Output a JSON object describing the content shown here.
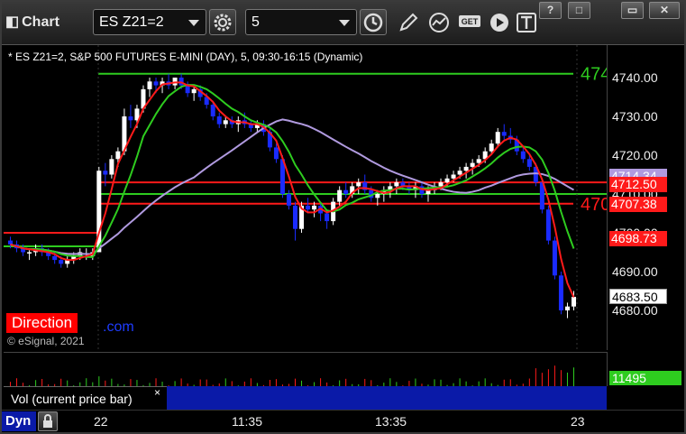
{
  "window": {
    "title": "Chart",
    "buttons": [
      "?",
      "□",
      "▭",
      "✕"
    ]
  },
  "toolbar": {
    "symbol_value": "ES Z21=2",
    "interval_value": "5",
    "icons": [
      "settings-gear-icon",
      "clock-icon",
      "draw-pencil-icon",
      "studies-icon",
      "get-data-icon",
      "play-icon",
      "text-tool-icon"
    ]
  },
  "chart": {
    "header": "* ES Z21=2, S&P 500 FUTURES E-MINI (DAY), 5, 09:30-16:15 (Dynamic)",
    "direction_label": "Direction",
    "com_text": ".com",
    "copyright": "© eSignal, 2021",
    "right_partial_labels": [
      {
        "text": "474",
        "color": "#2ecc1f"
      },
      {
        "text": "470",
        "color": "#ff1a1a"
      }
    ],
    "colors": {
      "up_candle": "#ffffff",
      "down_candle": "#1a2bff",
      "green_line": "#2ecc1f",
      "red_line": "#ff1a1a",
      "purple_line": "#b09adf"
    }
  },
  "price_axis": {
    "ticks": [
      "4740.00",
      "4730.00",
      "4720.00",
      "4710.00",
      "4700.00",
      "4690.00",
      "4680.00"
    ],
    "tags": [
      {
        "text": "4714.34",
        "bg": "#b09adf",
        "fg": "#ffffff"
      },
      {
        "text": "4712.50",
        "bg": "#ff1a1a",
        "fg": "#ffffff"
      },
      {
        "text": "4707.38",
        "bg": "#ff1a1a",
        "fg": "#ffffff"
      },
      {
        "text": "4698.73",
        "bg": "#ff1a1a",
        "fg": "#ffffff"
      },
      {
        "text": "4683.50",
        "bg": "#ffffff",
        "fg": "#000000"
      }
    ]
  },
  "volume": {
    "label": "Vol (current price bar)",
    "close_glyph": "×",
    "current_value": "11495"
  },
  "time_axis": {
    "labels": [
      "22",
      "11:35",
      "13:35",
      "23"
    ],
    "dyn_label": "Dyn"
  },
  "chart_data": {
    "type": "candlestick",
    "y_range": [
      4675,
      4745
    ],
    "levels": [
      {
        "name": "green-high",
        "value": 4741
      },
      {
        "name": "red-upper",
        "value": 4713
      },
      {
        "name": "green-mid",
        "value": 4710
      },
      {
        "name": "red-lower",
        "value": 4707.5
      },
      {
        "name": "green-prior",
        "value": 4696.5
      },
      {
        "name": "red-prior",
        "value": 4700
      }
    ],
    "candles": [
      [
        4698,
        4699,
        4696,
        4697
      ],
      [
        4697,
        4698,
        4695,
        4696
      ],
      [
        4696,
        4697,
        4694,
        4695
      ],
      [
        4695,
        4696,
        4693,
        4695
      ],
      [
        4695,
        4697,
        4694,
        4696
      ],
      [
        4696,
        4697,
        4694,
        4695
      ],
      [
        4695,
        4696,
        4693,
        4694
      ],
      [
        4694,
        4695,
        4692,
        4693
      ],
      [
        4693,
        4694,
        4691,
        4692
      ],
      [
        4692,
        4694,
        4691,
        4693
      ],
      [
        4693,
        4695,
        4692,
        4694
      ],
      [
        4694,
        4696,
        4693,
        4695
      ],
      [
        4694,
        4696,
        4693,
        4694
      ],
      [
        4694,
        4696,
        4693,
        4695
      ],
      [
        4695,
        4717,
        4695,
        4716
      ],
      [
        4716,
        4718,
        4712,
        4715
      ],
      [
        4715,
        4720,
        4714,
        4719
      ],
      [
        4719,
        4722,
        4717,
        4721
      ],
      [
        4721,
        4732,
        4720,
        4730
      ],
      [
        4730,
        4733,
        4727,
        4729
      ],
      [
        4729,
        4733,
        4727,
        4732
      ],
      [
        4732,
        4738,
        4731,
        4737
      ],
      [
        4737,
        4740,
        4735,
        4739
      ],
      [
        4739,
        4740,
        4736,
        4738
      ],
      [
        4738,
        4740,
        4736,
        4739
      ],
      [
        4739,
        4741,
        4737,
        4738
      ],
      [
        4738,
        4740,
        4737,
        4740
      ],
      [
        4740,
        4741,
        4737,
        4738
      ],
      [
        4738,
        4739,
        4735,
        4736
      ],
      [
        4736,
        4738,
        4734,
        4737
      ],
      [
        4737,
        4738,
        4734,
        4735
      ],
      [
        4735,
        4736,
        4732,
        4733
      ],
      [
        4733,
        4734,
        4729,
        4730
      ],
      [
        4730,
        4731,
        4727,
        4728
      ],
      [
        4728,
        4730,
        4727,
        4729
      ],
      [
        4729,
        4730,
        4727,
        4728
      ],
      [
        4728,
        4730,
        4726,
        4729
      ],
      [
        4729,
        4731,
        4727,
        4728
      ],
      [
        4728,
        4729,
        4726,
        4727
      ],
      [
        4727,
        4729,
        4726,
        4728
      ],
      [
        4728,
        4729,
        4725,
        4726
      ],
      [
        4726,
        4727,
        4721,
        4722
      ],
      [
        4722,
        4723,
        4718,
        4719
      ],
      [
        4719,
        4720,
        4709,
        4710
      ],
      [
        4710,
        4711,
        4706,
        4707
      ],
      [
        4707,
        4708,
        4698,
        4701
      ],
      [
        4701,
        4708,
        4700,
        4707
      ],
      [
        4707,
        4709,
        4705,
        4706
      ],
      [
        4706,
        4708,
        4704,
        4707
      ],
      [
        4707,
        4708,
        4703,
        4705
      ],
      [
        4705,
        4706,
        4701,
        4703
      ],
      [
        4703,
        4709,
        4702,
        4708
      ],
      [
        4708,
        4712,
        4707,
        4711
      ],
      [
        4711,
        4713,
        4709,
        4710
      ],
      [
        4710,
        4713,
        4709,
        4712
      ],
      [
        4712,
        4714,
        4710,
        4713
      ],
      [
        4713,
        4715,
        4710,
        4711
      ],
      [
        4711,
        4712,
        4708,
        4709
      ],
      [
        4709,
        4711,
        4707,
        4710
      ],
      [
        4710,
        4712,
        4708,
        4711
      ],
      [
        4711,
        4713,
        4709,
        4712
      ],
      [
        4712,
        4714,
        4710,
        4713
      ],
      [
        4713,
        4714,
        4711,
        4712
      ],
      [
        4712,
        4713,
        4710,
        4711
      ],
      [
        4711,
        4713,
        4709,
        4712
      ],
      [
        4712,
        4713,
        4709,
        4710
      ],
      [
        4710,
        4712,
        4708,
        4711
      ],
      [
        4711,
        4713,
        4710,
        4712
      ],
      [
        4712,
        4714,
        4711,
        4713
      ],
      [
        4713,
        4715,
        4712,
        4714
      ],
      [
        4714,
        4716,
        4713,
        4715
      ],
      [
        4715,
        4717,
        4714,
        4716
      ],
      [
        4716,
        4718,
        4714,
        4717
      ],
      [
        4717,
        4719,
        4715,
        4718
      ],
      [
        4718,
        4720,
        4717,
        4719
      ],
      [
        4719,
        4722,
        4718,
        4721
      ],
      [
        4721,
        4724,
        4720,
        4723
      ],
      [
        4723,
        4727,
        4722,
        4726
      ],
      [
        4726,
        4728,
        4724,
        4725
      ],
      [
        4725,
        4727,
        4723,
        4724
      ],
      [
        4724,
        4725,
        4720,
        4721
      ],
      [
        4721,
        4722,
        4718,
        4719
      ],
      [
        4719,
        4720,
        4716,
        4717
      ],
      [
        4717,
        4718,
        4712,
        4713
      ],
      [
        4713,
        4714,
        4705,
        4706
      ],
      [
        4706,
        4707,
        4697,
        4698
      ],
      [
        4698,
        4699,
        4688,
        4689
      ],
      [
        4689,
        4690,
        4679,
        4680
      ],
      [
        4680,
        4682,
        4678,
        4681
      ],
      [
        4681,
        4685,
        4680,
        4683.5
      ]
    ]
  }
}
